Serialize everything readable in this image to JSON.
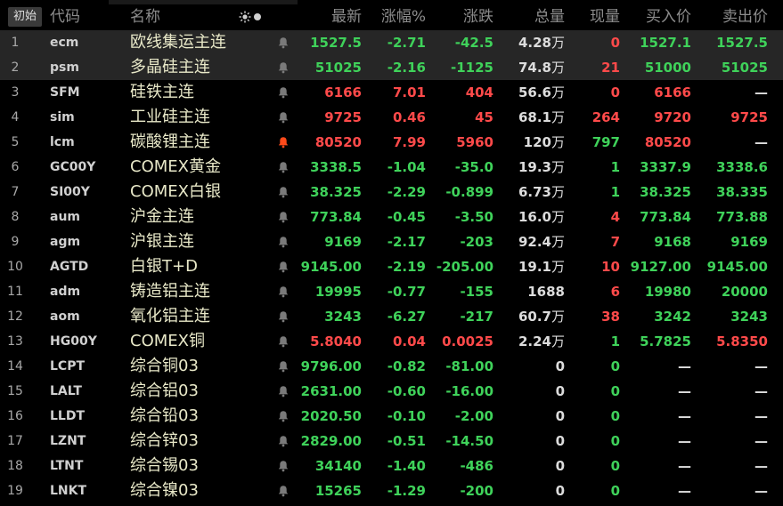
{
  "toolbar": {
    "init_label": "初始",
    "settings_icon": "settings-sun-icon"
  },
  "headers": {
    "code": "代码",
    "name": "名称",
    "latest": "最新",
    "pct": "涨幅%",
    "change": "涨跌",
    "volume": "总量",
    "current": "现量",
    "bid": "买入价",
    "ask": "卖出价"
  },
  "colors": {
    "up": "#ff4a4a",
    "down": "#3fd25a",
    "flat": "#dcdcdc",
    "bell_alert": "#ff4a1a",
    "bell_normal": "#7a7a7a"
  },
  "rows": [
    {
      "idx": "1",
      "code": "ecm",
      "name": "欧线集运主连",
      "latest": "1527.5",
      "pct": "-2.71",
      "change": "-42.5",
      "vol_num": "4.28",
      "vol_unit": "万",
      "current": "0",
      "bid": "1527.1",
      "ask": "1527.5",
      "dir": "down",
      "cur_dir": "up",
      "bid_dir": "down",
      "ask_dir": "down",
      "bell": "normal",
      "selected": true
    },
    {
      "idx": "2",
      "code": "psm",
      "name": "多晶硅主连",
      "latest": "51025",
      "pct": "-2.16",
      "change": "-1125",
      "vol_num": "74.8",
      "vol_unit": "万",
      "current": "21",
      "bid": "51000",
      "ask": "51025",
      "dir": "down",
      "cur_dir": "up",
      "bid_dir": "down",
      "ask_dir": "down",
      "bell": "normal",
      "selected": true
    },
    {
      "idx": "3",
      "code": "SFM",
      "name": "硅铁主连",
      "latest": "6166",
      "pct": "7.01",
      "change": "404",
      "vol_num": "56.6",
      "vol_unit": "万",
      "current": "0",
      "bid": "6166",
      "ask": "—",
      "dir": "up",
      "cur_dir": "up",
      "bid_dir": "up",
      "ask_dir": "none",
      "bell": "normal",
      "selected": false
    },
    {
      "idx": "4",
      "code": "sim",
      "name": "工业硅主连",
      "latest": "9725",
      "pct": "0.46",
      "change": "45",
      "vol_num": "68.1",
      "vol_unit": "万",
      "current": "264",
      "bid": "9720",
      "ask": "9725",
      "dir": "up",
      "cur_dir": "up",
      "bid_dir": "up",
      "ask_dir": "up",
      "bell": "normal",
      "selected": false
    },
    {
      "idx": "5",
      "code": "lcm",
      "name": "碳酸锂主连",
      "latest": "80520",
      "pct": "7.99",
      "change": "5960",
      "vol_num": "120",
      "vol_unit": "万",
      "current": "797",
      "bid": "80520",
      "ask": "—",
      "dir": "up",
      "cur_dir": "down",
      "bid_dir": "up",
      "ask_dir": "none",
      "bell": "alert",
      "selected": false
    },
    {
      "idx": "6",
      "code": "GC00Y",
      "name": "COMEX黄金",
      "latest": "3338.5",
      "pct": "-1.04",
      "change": "-35.0",
      "vol_num": "19.3",
      "vol_unit": "万",
      "current": "1",
      "bid": "3337.9",
      "ask": "3338.6",
      "dir": "down",
      "cur_dir": "down",
      "bid_dir": "down",
      "ask_dir": "down",
      "bell": "normal",
      "selected": false
    },
    {
      "idx": "7",
      "code": "SI00Y",
      "name": "COMEX白银",
      "latest": "38.325",
      "pct": "-2.29",
      "change": "-0.899",
      "vol_num": "6.73",
      "vol_unit": "万",
      "current": "1",
      "bid": "38.325",
      "ask": "38.335",
      "dir": "down",
      "cur_dir": "down",
      "bid_dir": "down",
      "ask_dir": "down",
      "bell": "normal",
      "selected": false
    },
    {
      "idx": "8",
      "code": "aum",
      "name": "沪金主连",
      "latest": "773.84",
      "pct": "-0.45",
      "change": "-3.50",
      "vol_num": "16.0",
      "vol_unit": "万",
      "current": "4",
      "bid": "773.84",
      "ask": "773.88",
      "dir": "down",
      "cur_dir": "up",
      "bid_dir": "down",
      "ask_dir": "down",
      "bell": "normal",
      "selected": false
    },
    {
      "idx": "9",
      "code": "agm",
      "name": "沪银主连",
      "latest": "9169",
      "pct": "-2.17",
      "change": "-203",
      "vol_num": "92.4",
      "vol_unit": "万",
      "current": "7",
      "bid": "9168",
      "ask": "9169",
      "dir": "down",
      "cur_dir": "up",
      "bid_dir": "down",
      "ask_dir": "down",
      "bell": "normal",
      "selected": false
    },
    {
      "idx": "10",
      "code": "AGTD",
      "name": "白银T+D",
      "latest": "9145.00",
      "pct": "-2.19",
      "change": "-205.00",
      "vol_num": "19.1",
      "vol_unit": "万",
      "current": "10",
      "bid": "9127.00",
      "ask": "9145.00",
      "dir": "down",
      "cur_dir": "up",
      "bid_dir": "down",
      "ask_dir": "down",
      "bell": "normal",
      "selected": false
    },
    {
      "idx": "11",
      "code": "adm",
      "name": "铸造铝主连",
      "latest": "19995",
      "pct": "-0.77",
      "change": "-155",
      "vol_num": "1688",
      "vol_unit": "",
      "current": "6",
      "bid": "19980",
      "ask": "20000",
      "dir": "down",
      "cur_dir": "up",
      "bid_dir": "down",
      "ask_dir": "down",
      "bell": "normal",
      "selected": false
    },
    {
      "idx": "12",
      "code": "aom",
      "name": "氧化铝主连",
      "latest": "3243",
      "pct": "-6.27",
      "change": "-217",
      "vol_num": "60.7",
      "vol_unit": "万",
      "current": "38",
      "bid": "3242",
      "ask": "3243",
      "dir": "down",
      "cur_dir": "up",
      "bid_dir": "down",
      "ask_dir": "down",
      "bell": "normal",
      "selected": false
    },
    {
      "idx": "13",
      "code": "HG00Y",
      "name": "COMEX铜",
      "latest": "5.8040",
      "pct": "0.04",
      "change": "0.0025",
      "vol_num": "2.24",
      "vol_unit": "万",
      "current": "1",
      "bid": "5.7825",
      "ask": "5.8350",
      "dir": "up",
      "cur_dir": "down",
      "bid_dir": "down",
      "ask_dir": "up",
      "bell": "normal",
      "selected": false
    },
    {
      "idx": "14",
      "code": "LCPT",
      "name": "综合铜03",
      "latest": "9796.00",
      "pct": "-0.82",
      "change": "-81.00",
      "vol_num": "0",
      "vol_unit": "",
      "current": "0",
      "bid": "—",
      "ask": "—",
      "dir": "down",
      "cur_dir": "down",
      "bid_dir": "none",
      "ask_dir": "none",
      "bell": "normal",
      "selected": false
    },
    {
      "idx": "15",
      "code": "LALT",
      "name": "综合铝03",
      "latest": "2631.00",
      "pct": "-0.60",
      "change": "-16.00",
      "vol_num": "0",
      "vol_unit": "",
      "current": "0",
      "bid": "—",
      "ask": "—",
      "dir": "down",
      "cur_dir": "down",
      "bid_dir": "none",
      "ask_dir": "none",
      "bell": "normal",
      "selected": false
    },
    {
      "idx": "16",
      "code": "LLDT",
      "name": "综合铅03",
      "latest": "2020.50",
      "pct": "-0.10",
      "change": "-2.00",
      "vol_num": "0",
      "vol_unit": "",
      "current": "0",
      "bid": "—",
      "ask": "—",
      "dir": "down",
      "cur_dir": "down",
      "bid_dir": "none",
      "ask_dir": "none",
      "bell": "normal",
      "selected": false
    },
    {
      "idx": "17",
      "code": "LZNT",
      "name": "综合锌03",
      "latest": "2829.00",
      "pct": "-0.51",
      "change": "-14.50",
      "vol_num": "0",
      "vol_unit": "",
      "current": "0",
      "bid": "—",
      "ask": "—",
      "dir": "down",
      "cur_dir": "down",
      "bid_dir": "none",
      "ask_dir": "none",
      "bell": "normal",
      "selected": false
    },
    {
      "idx": "18",
      "code": "LTNT",
      "name": "综合锡03",
      "latest": "34140",
      "pct": "-1.40",
      "change": "-486",
      "vol_num": "0",
      "vol_unit": "",
      "current": "0",
      "bid": "—",
      "ask": "—",
      "dir": "down",
      "cur_dir": "down",
      "bid_dir": "none",
      "ask_dir": "none",
      "bell": "normal",
      "selected": false
    },
    {
      "idx": "19",
      "code": "LNKT",
      "name": "综合镍03",
      "latest": "15265",
      "pct": "-1.29",
      "change": "-200",
      "vol_num": "0",
      "vol_unit": "",
      "current": "0",
      "bid": "—",
      "ask": "—",
      "dir": "down",
      "cur_dir": "down",
      "bid_dir": "none",
      "ask_dir": "none",
      "bell": "normal",
      "selected": false
    }
  ]
}
